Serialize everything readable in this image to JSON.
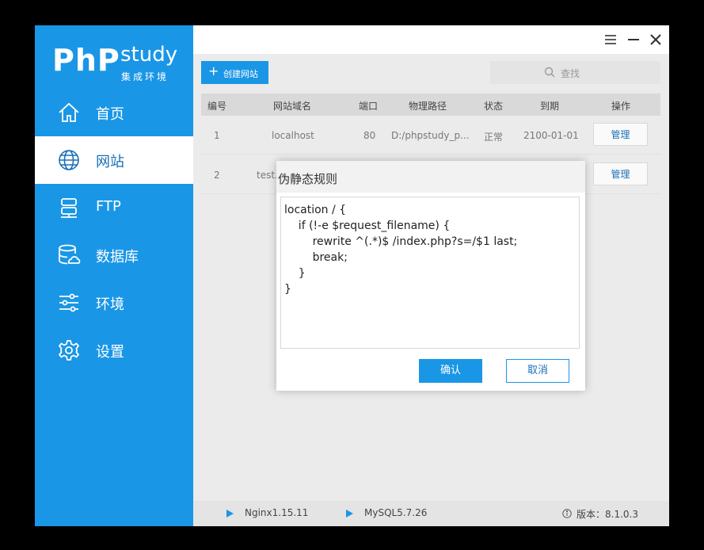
{
  "logo": {
    "php": "PhP",
    "study": "study",
    "subtitle": "集成环境"
  },
  "sidebar": {
    "items": [
      {
        "label": "首页",
        "icon": "home-icon"
      },
      {
        "label": "网站",
        "icon": "globe-icon",
        "active": true
      },
      {
        "label": "FTP",
        "icon": "server-icon"
      },
      {
        "label": "数据库",
        "icon": "database-icon"
      },
      {
        "label": "环境",
        "icon": "sliders-icon"
      },
      {
        "label": "设置",
        "icon": "gear-icon"
      }
    ]
  },
  "toolbar": {
    "create_label": "创建网站",
    "create_icon": "+",
    "search_placeholder": "查找"
  },
  "table": {
    "headers": [
      "编号",
      "网站域名",
      "端口",
      "物理路径",
      "状态",
      "到期",
      "操作"
    ],
    "rows": [
      {
        "id": "1",
        "domain": "localhost",
        "port": "80",
        "path": "D:/phpstudy_p...",
        "status": "正常",
        "expire": "2100-01-01",
        "action": "管理"
      },
      {
        "id": "2",
        "domain": "test.",
        "port": "",
        "path": "",
        "status": "",
        "expire": "",
        "action": "管理"
      }
    ]
  },
  "modal": {
    "title": "伪静态规则",
    "text": "location / {\n    if (!-e $request_filename) {\n        rewrite ^(.*)$ /index.php?s=/$1 last;\n        break;\n    }\n}",
    "ok_label": "确认",
    "cancel_label": "取消"
  },
  "status": {
    "nginx": "Nginx1.15.11",
    "mysql": "MySQL5.7.26",
    "version": "版本：8.1.0.3"
  },
  "colors": {
    "accent": "#1a96e6",
    "sidebar_bg": "#1a96e6",
    "active_text": "#1a6fb8"
  }
}
